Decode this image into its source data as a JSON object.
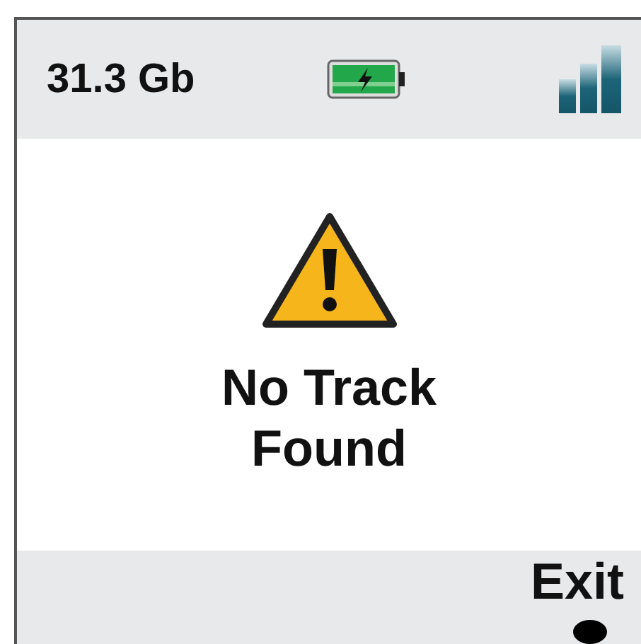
{
  "status_bar": {
    "storage": "31.3 Gb"
  },
  "message": {
    "text": "No Track Found"
  },
  "soft_keys": [
    {
      "label": "Exit"
    }
  ]
}
